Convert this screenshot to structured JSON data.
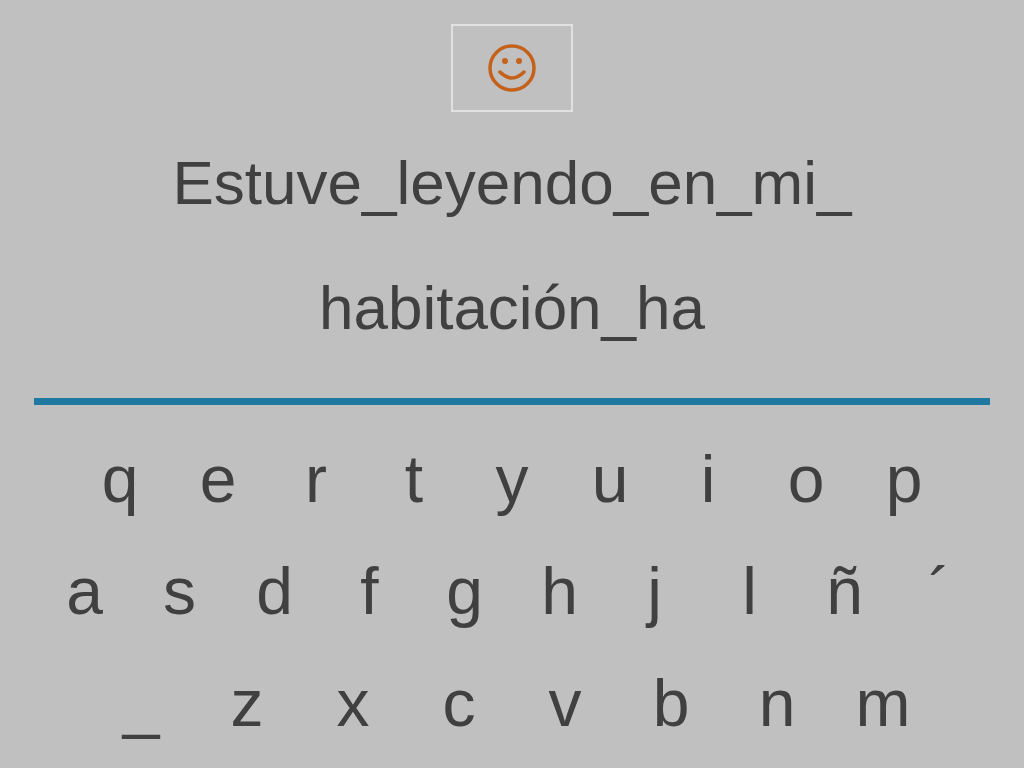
{
  "sentence_lines": [
    "Estuve_leyendo_en_mi_",
    "habitación_ha"
  ],
  "keyboard_rows": [
    [
      "q",
      "e",
      "r",
      "t",
      "y",
      "u",
      "i",
      "o",
      "p"
    ],
    [
      "a",
      "s",
      "d",
      "f",
      "g",
      "h",
      "j",
      "l",
      "ñ",
      "´"
    ],
    [
      "_",
      "z",
      "x",
      "c",
      "v",
      "b",
      "n",
      "m"
    ]
  ]
}
